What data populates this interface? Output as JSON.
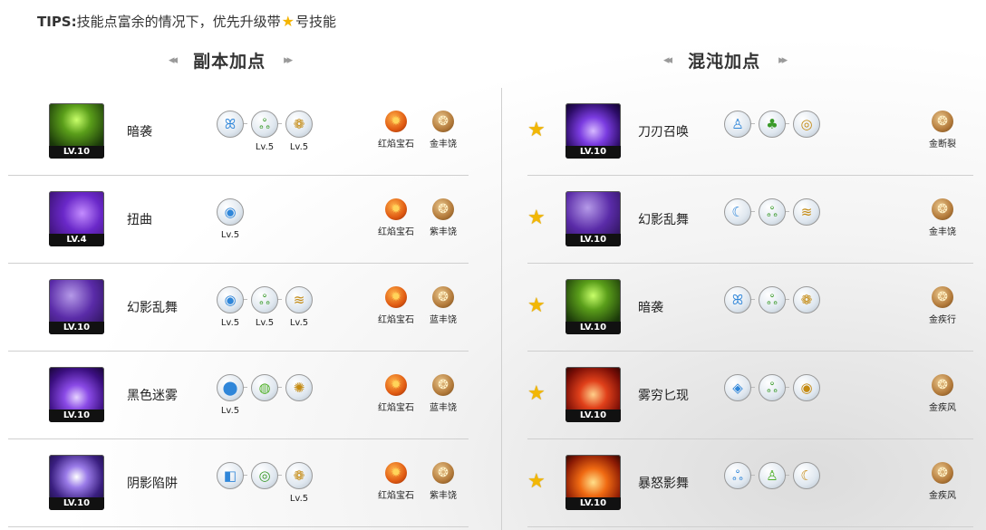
{
  "tips": {
    "prefix": "TIPS:",
    "text_before": "技能点富余的情况下，优先升级带",
    "text_after": "号技能"
  },
  "sections": {
    "left_title": "副本加点",
    "right_title": "混沌加点"
  },
  "left": [
    {
      "name": "暗袭",
      "level": "LV.10",
      "runes": [
        {
          "glyph": "ꕤ",
          "color": "blue",
          "lv": ""
        },
        {
          "glyph": "ஃ",
          "color": "green",
          "lv": "Lv.5"
        },
        {
          "glyph": "❁",
          "color": "gold",
          "lv": "Lv.5"
        }
      ],
      "gems": [
        {
          "label": "红焰宝石",
          "type": "red"
        },
        {
          "label": "金丰饶",
          "type": "brown"
        }
      ]
    },
    {
      "name": "扭曲",
      "level": "LV.4",
      "runes": [
        {
          "glyph": "◉",
          "color": "blue",
          "lv": "Lv.5"
        }
      ],
      "gems": [
        {
          "label": "红焰宝石",
          "type": "red"
        },
        {
          "label": "紫丰饶",
          "type": "brown"
        }
      ]
    },
    {
      "name": "幻影乱舞",
      "level": "LV.10",
      "runes": [
        {
          "glyph": "◉",
          "color": "blue",
          "lv": "Lv.5"
        },
        {
          "glyph": "ஃ",
          "color": "green",
          "lv": "Lv.5"
        },
        {
          "glyph": "≋",
          "color": "gold",
          "lv": "Lv.5"
        }
      ],
      "gems": [
        {
          "label": "红焰宝石",
          "type": "red"
        },
        {
          "label": "蓝丰饶",
          "type": "brown"
        }
      ]
    },
    {
      "name": "黑色迷雾",
      "level": "LV.10",
      "runes": [
        {
          "glyph": "⬤",
          "color": "blue",
          "lv": "Lv.5"
        },
        {
          "glyph": "◍",
          "color": "lime",
          "lv": ""
        },
        {
          "glyph": "✺",
          "color": "gold",
          "lv": ""
        }
      ],
      "gems": [
        {
          "label": "红焰宝石",
          "type": "red"
        },
        {
          "label": "蓝丰饶",
          "type": "brown"
        }
      ]
    },
    {
      "name": "阴影陷阱",
      "level": "LV.10",
      "runes": [
        {
          "glyph": "◧",
          "color": "blue",
          "lv": ""
        },
        {
          "glyph": "◎",
          "color": "green",
          "lv": ""
        },
        {
          "glyph": "❁",
          "color": "gold",
          "lv": "Lv.5"
        }
      ],
      "gems": [
        {
          "label": "红焰宝石",
          "type": "red"
        },
        {
          "label": "紫丰饶",
          "type": "brown"
        }
      ]
    }
  ],
  "right": [
    {
      "name": "刀刃召唤",
      "level": "LV.10",
      "runes": [
        {
          "glyph": "♙",
          "color": "blue",
          "lv": ""
        },
        {
          "glyph": "♣",
          "color": "green",
          "lv": ""
        },
        {
          "glyph": "◎",
          "color": "gold",
          "lv": ""
        }
      ],
      "gems": [
        {
          "label": "金断裂",
          "type": "brown"
        }
      ]
    },
    {
      "name": "幻影乱舞",
      "level": "LV.10",
      "runes": [
        {
          "glyph": "☾",
          "color": "blue",
          "lv": ""
        },
        {
          "glyph": "ஃ",
          "color": "green",
          "lv": ""
        },
        {
          "glyph": "≋",
          "color": "gold",
          "lv": ""
        }
      ],
      "gems": [
        {
          "label": "金丰饶",
          "type": "brown"
        }
      ]
    },
    {
      "name": "暗袭",
      "level": "LV.10",
      "runes": [
        {
          "glyph": "ꕤ",
          "color": "blue",
          "lv": ""
        },
        {
          "glyph": "ஃ",
          "color": "green",
          "lv": ""
        },
        {
          "glyph": "❁",
          "color": "gold",
          "lv": ""
        }
      ],
      "gems": [
        {
          "label": "金疾行",
          "type": "brown"
        }
      ]
    },
    {
      "name": "雾穷匕现",
      "level": "LV.10",
      "runes": [
        {
          "glyph": "◈",
          "color": "blue",
          "lv": ""
        },
        {
          "glyph": "ஃ",
          "color": "green",
          "lv": ""
        },
        {
          "glyph": "◉",
          "color": "gold",
          "lv": ""
        }
      ],
      "gems": [
        {
          "label": "金疾风",
          "type": "brown"
        }
      ]
    },
    {
      "name": "暴怒影舞",
      "level": "LV.10",
      "runes": [
        {
          "glyph": "ஃ",
          "color": "blue",
          "lv": ""
        },
        {
          "glyph": "♙",
          "color": "lime",
          "lv": ""
        },
        {
          "glyph": "☾",
          "color": "gold",
          "lv": ""
        }
      ],
      "gems": [
        {
          "label": "金疾风",
          "type": "brown"
        }
      ]
    }
  ]
}
